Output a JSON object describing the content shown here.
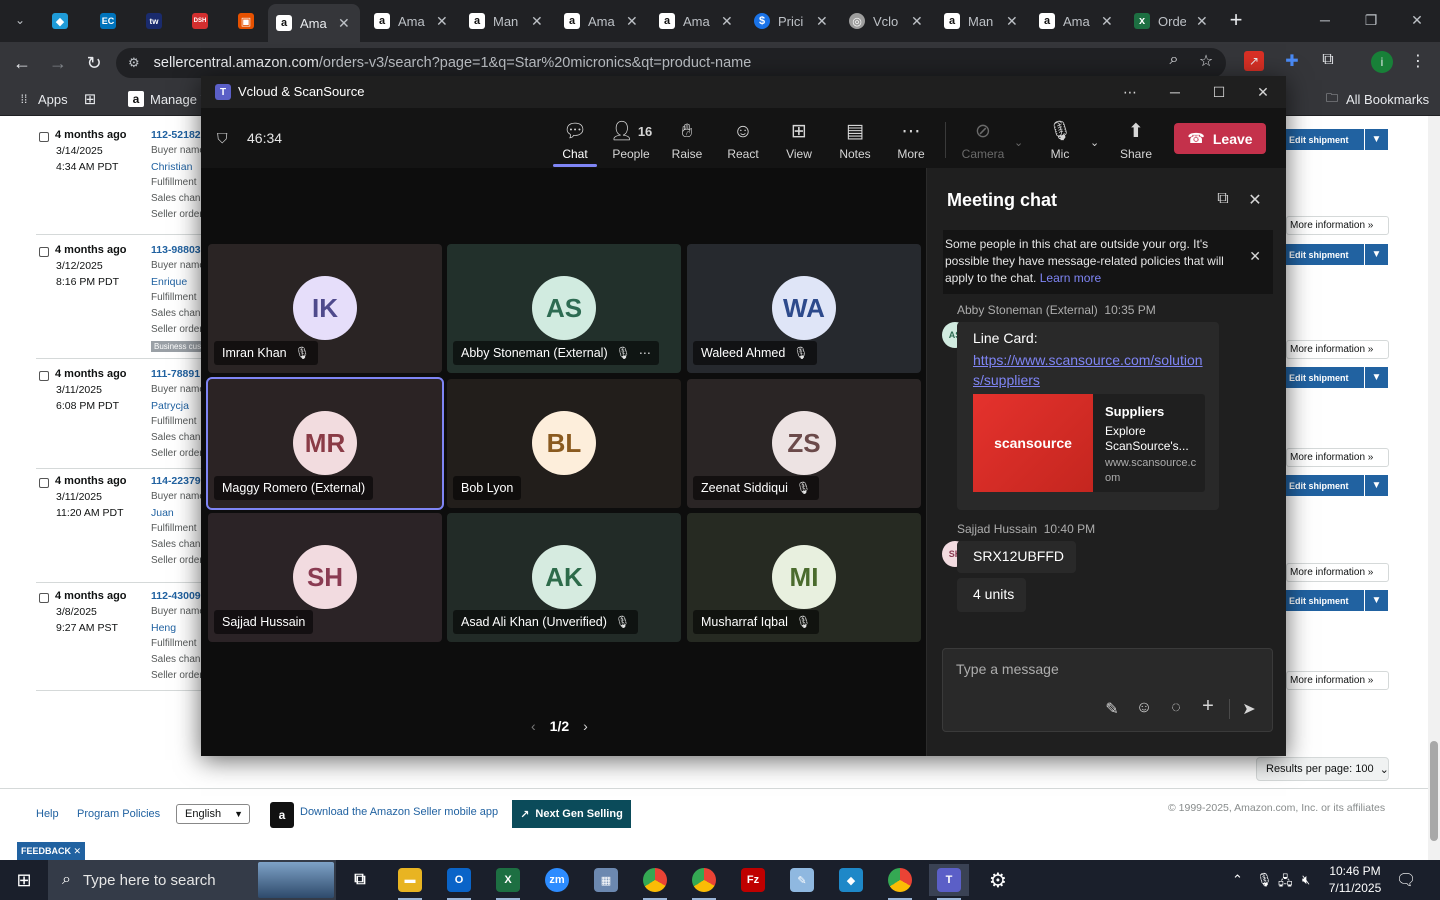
{
  "browser": {
    "tabs": [
      {
        "title": "",
        "icon": "generic-blue-icon",
        "color": "#1f9bd7",
        "glyph": "◆"
      },
      {
        "title": "",
        "icon": "ec-icon",
        "color": "#0073bb",
        "glyph": "EC"
      },
      {
        "title": "",
        "icon": "tw-icon",
        "color": "#1a2b6d",
        "glyph": "tw"
      },
      {
        "title": "",
        "icon": "dsh-icon",
        "color": "#d32f2f",
        "glyph": "DSH"
      },
      {
        "title": "",
        "icon": "box-icon",
        "color": "#e65100",
        "glyph": "▣"
      },
      {
        "title": "Ama",
        "icon": "amazon-icon",
        "color": "#ffffff",
        "glyph": "a",
        "active": true
      },
      {
        "title": "Ama",
        "icon": "amazon-icon",
        "color": "#ffffff",
        "glyph": "a"
      },
      {
        "title": "Man",
        "icon": "amazon-icon",
        "color": "#ffffff",
        "glyph": "a"
      },
      {
        "title": "Ama",
        "icon": "amazon-icon",
        "color": "#ffffff",
        "glyph": "a"
      },
      {
        "title": "Ama",
        "icon": "amazon-icon",
        "color": "#ffffff",
        "glyph": "a"
      },
      {
        "title": "Prici",
        "icon": "dollar-icon",
        "color": "#1a73e8",
        "glyph": "$"
      },
      {
        "title": "Vclo",
        "icon": "vcloud-icon",
        "color": "#9e9e9e",
        "glyph": "◎"
      },
      {
        "title": "Man",
        "icon": "amazon-icon",
        "color": "#ffffff",
        "glyph": "a"
      },
      {
        "title": "Ama",
        "icon": "amazon-icon",
        "color": "#ffffff",
        "glyph": "a"
      },
      {
        "title": "Orde",
        "icon": "excel-icon",
        "color": "#1d6f42",
        "glyph": "x"
      }
    ],
    "url_host": "sellercentral.amazon.com",
    "url_path": "/orders-v3/search?page=1&q=Star%20micronics&qt=product-name",
    "bookmarks": {
      "apps": "Apps",
      "manage": "Manage Y",
      "all": "All Bookmarks"
    }
  },
  "seller": {
    "orders": [
      {
        "ago": "4 months ago",
        "date": "3/14/2025",
        "time": "4:34 AM PDT",
        "number": "112-52182",
        "buyer": "Christian",
        "business": false
      },
      {
        "ago": "4 months ago",
        "date": "3/12/2025",
        "time": "8:16 PM PDT",
        "number": "113-98803",
        "buyer": "Enrique",
        "business": true
      },
      {
        "ago": "4 months ago",
        "date": "3/11/2025",
        "time": "6:08 PM PDT",
        "number": "111-78891",
        "buyer": "Patrycja",
        "business": false
      },
      {
        "ago": "4 months ago",
        "date": "3/11/2025",
        "time": "11:20 AM PDT",
        "number": "114-22379",
        "buyer": "Juan",
        "business": false
      },
      {
        "ago": "4 months ago",
        "date": "3/8/2025",
        "time": "9:27 AM PST",
        "number": "112-43009",
        "buyer": "Heng",
        "business": false
      }
    ],
    "labels": {
      "buyer_name": "Buyer name",
      "fulfillment": "Fulfillment",
      "sales_channel": "Sales chann",
      "seller_order": "Seller order",
      "business": "Business cust"
    },
    "edit_shipment": "Edit shipment",
    "more_information": "More information »",
    "results_per_page": "Results per page: 100",
    "footer": {
      "help": "Help",
      "policies": "Program Policies",
      "language": "English",
      "app_download": "Download the Amazon Seller mobile app",
      "next_gen": "Next Gen Selling",
      "copyright": "© 1999-2025, Amazon.com, Inc. or its affiliates",
      "feedback": "FEEDBACK ✕"
    }
  },
  "teams": {
    "window_title": "Vcloud & ScanSource",
    "timer": "46:34",
    "toolbar": {
      "chat": "Chat",
      "people": "People",
      "people_count": "16",
      "raise": "Raise",
      "react": "React",
      "view": "View",
      "notes": "Notes",
      "more": "More",
      "camera": "Camera",
      "mic": "Mic",
      "share": "Share",
      "leave": "Leave"
    },
    "participants": [
      {
        "initials": "IK",
        "name": "Imran Khan",
        "muted": true,
        "bg": "#e6defa",
        "fg": "#4f4a8c",
        "tile": "#2a2424"
      },
      {
        "initials": "AS",
        "name": "Abby Stoneman (External)",
        "muted": true,
        "more": true,
        "bg": "#d1ebe0",
        "fg": "#2d6b52",
        "tile": "#22302b"
      },
      {
        "initials": "WA",
        "name": "Waleed Ahmed",
        "muted": true,
        "bg": "#dfe5f7",
        "fg": "#2d4a8c",
        "tile": "#26292e"
      },
      {
        "initials": "MR",
        "name": "Maggy Romero (External)",
        "muted": false,
        "speaking": true,
        "bg": "#f2dcdf",
        "fg": "#8a3b46",
        "tile": "#2b2324"
      },
      {
        "initials": "BL",
        "name": "Bob Lyon",
        "muted": false,
        "bg": "#fdeedb",
        "fg": "#8a5a1f",
        "tile": "#221e1b"
      },
      {
        "initials": "ZS",
        "name": "Zeenat Siddiqui",
        "muted": true,
        "bg": "#ede3e3",
        "fg": "#6b4a4a",
        "tile": "#2a2525"
      },
      {
        "initials": "SH",
        "name": "Sajjad Hussain",
        "muted": false,
        "bg": "#f2dbe0",
        "fg": "#8a3b52",
        "tile": "#2b2326"
      },
      {
        "initials": "AK",
        "name": "Asad Ali Khan (Unverified)",
        "muted": true,
        "bg": "#d6ebe0",
        "fg": "#2d6b4a",
        "tile": "#222b27"
      },
      {
        "initials": "MI",
        "name": "Musharraf Iqbal",
        "muted": true,
        "bg": "#e8f0df",
        "fg": "#4a6b2d",
        "tile": "#262a22"
      }
    ],
    "pager": "1/2",
    "chat": {
      "title": "Meeting chat",
      "banner": "Some people in this chat are outside your org. It's possible they have message-related policies that will apply to the chat.",
      "banner_link": "Learn more",
      "messages": [
        {
          "sender": "Abby Stoneman (External)",
          "time": "10:35 PM",
          "initials": "AS",
          "text": "Line Card:",
          "link": "https://www.scansource.com/solutions/suppliers",
          "card": {
            "brand": "scansource",
            "title": "Suppliers",
            "desc": "Explore ScanSource's...",
            "url": "www.scansource.com"
          }
        },
        {
          "sender": "Sajjad Hussain",
          "time": "10:40 PM",
          "initials": "SH",
          "text": "SRX12UBFFD",
          "text2": "4 units"
        }
      ],
      "placeholder": "Type a message"
    }
  },
  "taskbar": {
    "search_placeholder": "Type here to search",
    "time": "10:46 PM",
    "date": "7/11/2025"
  }
}
